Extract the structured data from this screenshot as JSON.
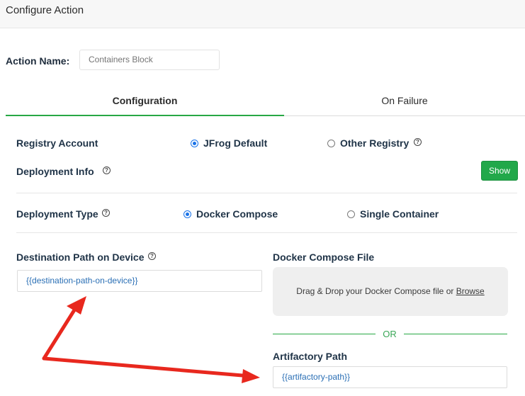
{
  "header": {
    "title": "Configure Action"
  },
  "action_name": {
    "label": "Action Name:",
    "placeholder": "Containers Block"
  },
  "tabs": [
    {
      "label": "Configuration",
      "active": true
    },
    {
      "label": "On Failure",
      "active": false
    }
  ],
  "registry": {
    "label": "Registry Account",
    "options": [
      {
        "label": "JFrog Default",
        "selected": true
      },
      {
        "label": "Other Registry",
        "selected": false
      }
    ]
  },
  "deployment_info": {
    "label": "Deployment Info",
    "show_label": "Show"
  },
  "deployment_type": {
    "label": "Deployment Type",
    "options": [
      {
        "label": "Docker Compose",
        "selected": true
      },
      {
        "label": "Single Container",
        "selected": false
      }
    ]
  },
  "destination": {
    "label": "Destination Path on Device",
    "value": "{{destination-path-on-device}}"
  },
  "compose": {
    "label": "Docker Compose File",
    "drop_text": "Drag & Drop your Docker Compose file or ",
    "browse_label": "Browse",
    "or_label": "OR"
  },
  "artifactory": {
    "label": "Artifactory Path",
    "value": "{{artifactory-path}}"
  },
  "icons": {
    "help": "question-circle-icon",
    "annotation": "red-arrow"
  },
  "colors": {
    "accent": "#27a844",
    "radio": "#1a73e8",
    "annotation": "#e8281e",
    "field_text": "#2a6fb5"
  }
}
